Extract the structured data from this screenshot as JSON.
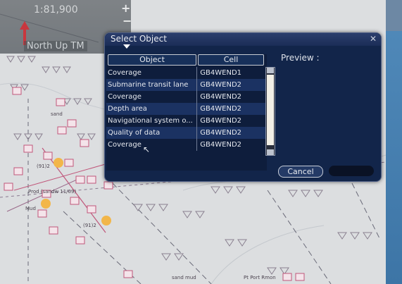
{
  "overlay": {
    "scale": "1:81,900",
    "zoom_in": "+",
    "zoom_out": "−",
    "orientation": "North Up TM"
  },
  "dialog": {
    "title": "Select Object",
    "columns": {
      "object": "Object",
      "cell": "Cell"
    },
    "rows": [
      {
        "object": "Coverage",
        "cell": "GB4WEND1"
      },
      {
        "object": "Submarine transit lane",
        "cell": "GB4WEND2"
      },
      {
        "object": "Coverage",
        "cell": "GB4WEND2"
      },
      {
        "object": "Depth area",
        "cell": "GB4WEND2"
      },
      {
        "object": "Navigational system o...",
        "cell": "GB4WEND2"
      },
      {
        "object": "Quality of data",
        "cell": "GB4WEND2"
      },
      {
        "object": "Coverage",
        "cell": "GB4WEND2"
      }
    ],
    "preview_label": "Preview :",
    "cancel_label": "Cancel",
    "close_glyph": "✕"
  },
  "chart_labels": {
    "sand_1": "sand",
    "pos_1": "(91)2",
    "prod": "Prod (sandw 11/09)",
    "mud": "Mud",
    "pos_2": "(91)2",
    "sand_mud": "sand mud",
    "port": "Pt Port Rmon"
  },
  "colors": {
    "dialog_bg": "#12254a",
    "accent_orange": "#f2b64a",
    "chart_symbol": "#c0567a"
  }
}
